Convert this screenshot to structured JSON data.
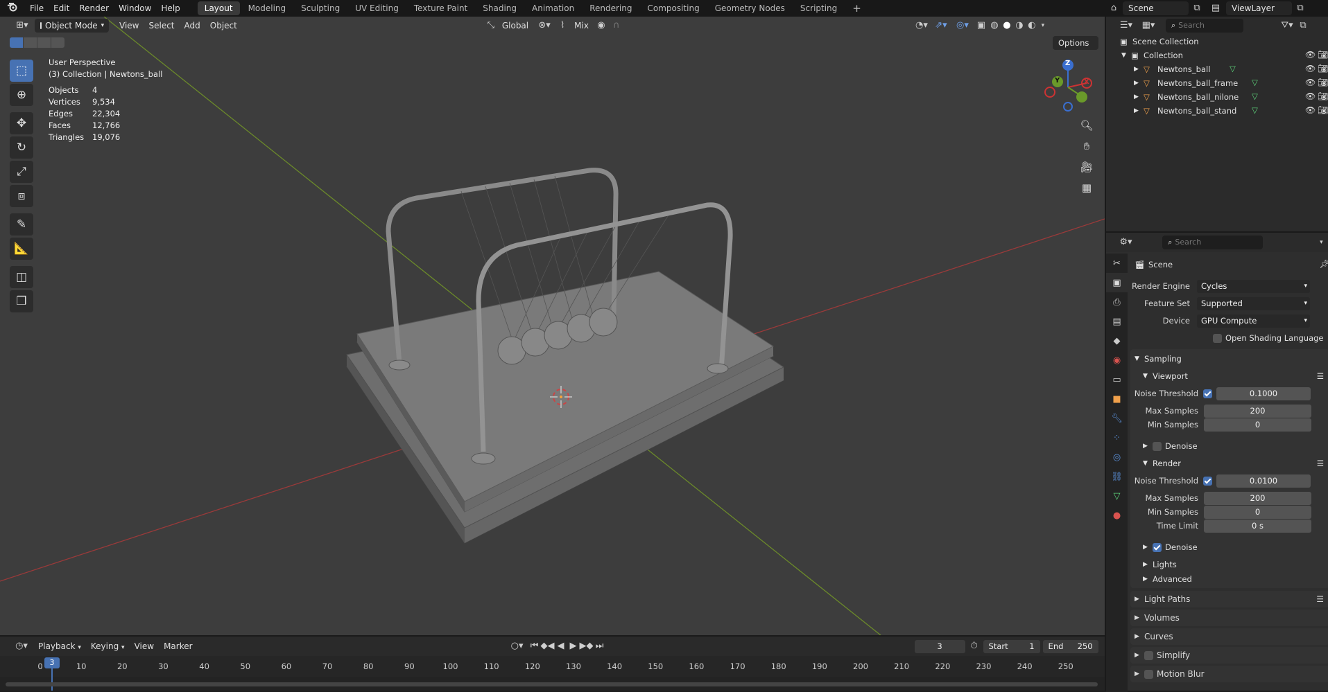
{
  "topbar": {
    "menus": [
      "File",
      "Edit",
      "Render",
      "Window",
      "Help"
    ],
    "workspaces": [
      "Layout",
      "Modeling",
      "Sculpting",
      "UV Editing",
      "Texture Paint",
      "Shading",
      "Animation",
      "Rendering",
      "Compositing",
      "Geometry Nodes",
      "Scripting"
    ],
    "active_workspace": "Layout",
    "add_workspace": "+",
    "scene": "Scene",
    "view_layer": "ViewLayer"
  },
  "viewport_header": {
    "mode": "Object Mode",
    "menus": [
      "View",
      "Select",
      "Add",
      "Object"
    ],
    "orientation": "Global",
    "snap_mode": "Mix",
    "options": "Options"
  },
  "overlay": {
    "perspective": "User Perspective",
    "context": "(3) Collection | Newtons_ball",
    "stats": [
      {
        "label": "Objects",
        "value": "4"
      },
      {
        "label": "Vertices",
        "value": "9,534"
      },
      {
        "label": "Edges",
        "value": "22,304"
      },
      {
        "label": "Faces",
        "value": "12,766"
      },
      {
        "label": "Triangles",
        "value": "19,076"
      }
    ]
  },
  "gizmo": {
    "x": "X",
    "y": "Y",
    "z": "Z"
  },
  "outliner": {
    "search_placeholder": "Search",
    "root": "Scene Collection",
    "collection": "Collection",
    "objects": [
      "Newtons_ball",
      "Newtons_ball_frame",
      "Newtons_ball_nilone",
      "Newtons_ball_stand"
    ]
  },
  "properties": {
    "search_placeholder": "Search",
    "context": "Scene",
    "render_engine": {
      "label": "Render Engine",
      "value": "Cycles"
    },
    "feature_set": {
      "label": "Feature Set",
      "value": "Supported"
    },
    "device": {
      "label": "Device",
      "value": "GPU Compute"
    },
    "osl": {
      "label": "Open Shading Language",
      "checked": false
    },
    "sampling": {
      "title": "Sampling",
      "viewport": {
        "title": "Viewport",
        "noise_threshold_label": "Noise Threshold",
        "noise_threshold": "0.1000",
        "max_samples_label": "Max Samples",
        "max_samples": "200",
        "min_samples_label": "Min Samples",
        "min_samples": "0",
        "denoise": "Denoise"
      },
      "render": {
        "title": "Render",
        "noise_threshold_label": "Noise Threshold",
        "noise_threshold": "0.0100",
        "max_samples_label": "Max Samples",
        "max_samples": "200",
        "min_samples_label": "Min Samples",
        "min_samples": "0",
        "time_limit_label": "Time Limit",
        "time_limit": "0 s",
        "denoise": "Denoise"
      },
      "lights": "Lights",
      "advanced": "Advanced"
    },
    "panels": [
      "Light Paths",
      "Volumes",
      "Curves",
      "Simplify",
      "Motion Blur"
    ]
  },
  "timeline": {
    "menus": [
      "Playback",
      "Keying",
      "View",
      "Marker"
    ],
    "current_frame": "3",
    "start_label": "Start",
    "start": "1",
    "end_label": "End",
    "end": "250",
    "ticks": [
      "0",
      "10",
      "20",
      "30",
      "40",
      "50",
      "60",
      "70",
      "80",
      "90",
      "100",
      "110",
      "120",
      "130",
      "140",
      "150",
      "160",
      "170",
      "180",
      "190",
      "200",
      "210",
      "220",
      "230",
      "240",
      "250"
    ]
  }
}
